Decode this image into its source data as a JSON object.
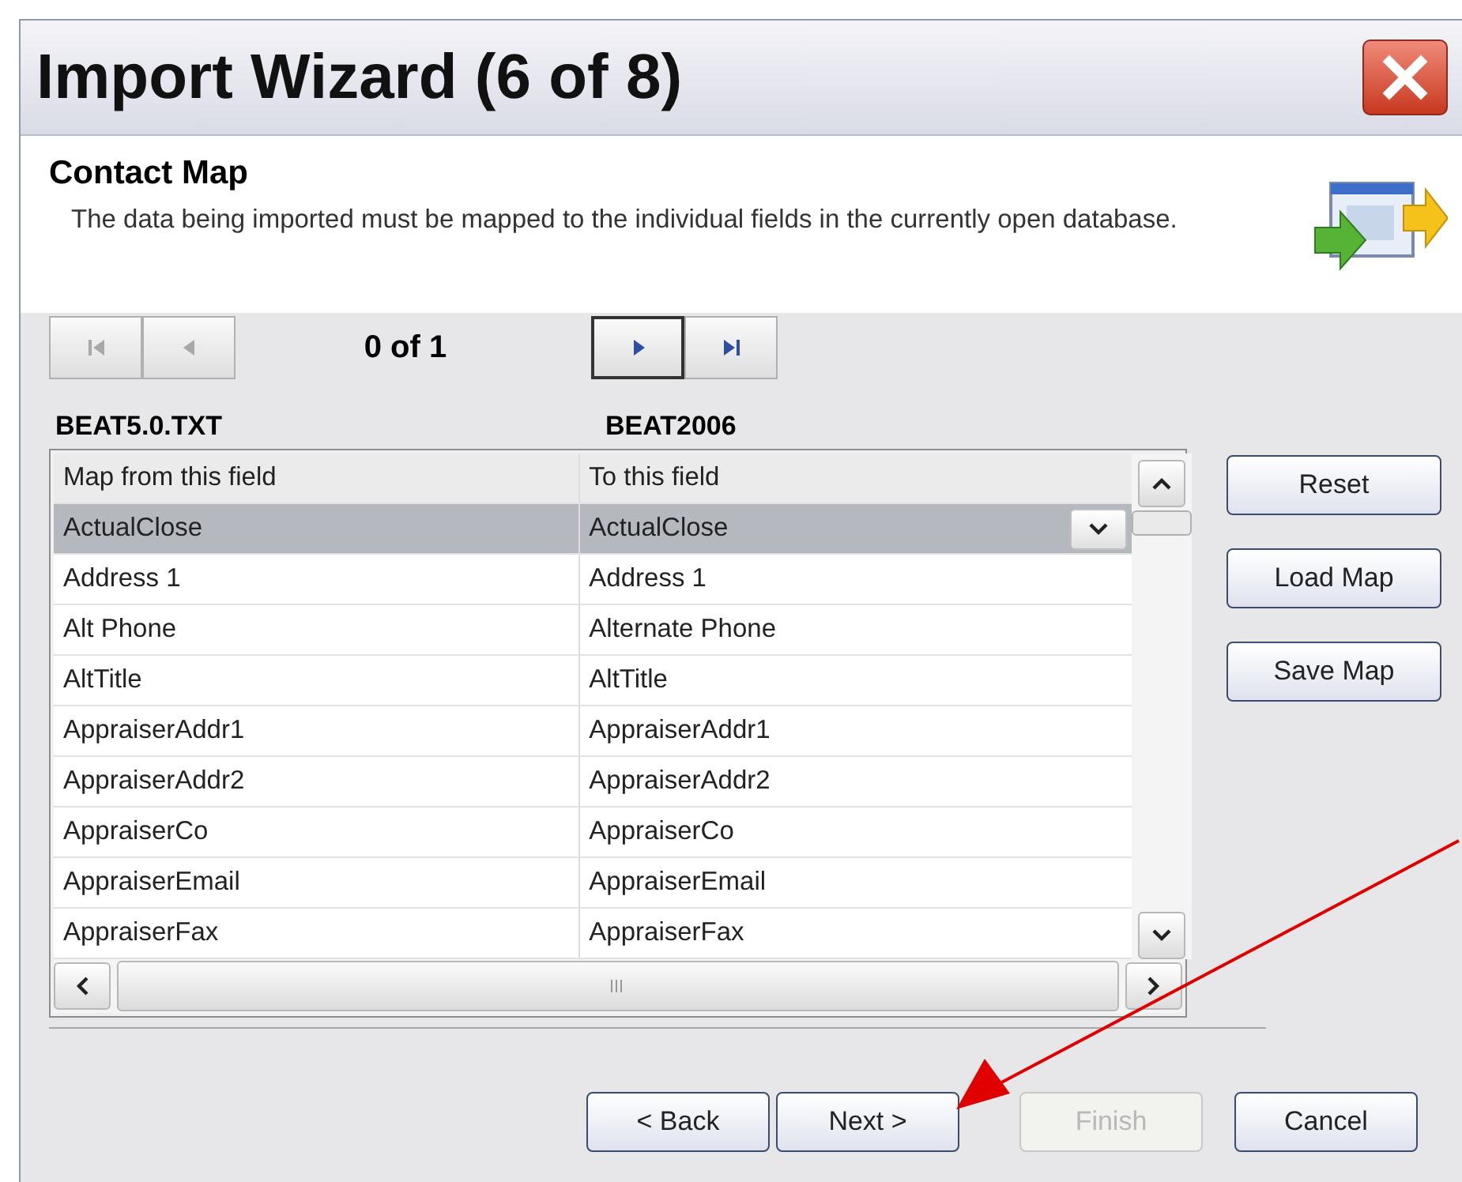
{
  "window": {
    "title": "Import Wizard (6 of 8)"
  },
  "header": {
    "title": "Contact Map",
    "description": "The data being imported must be mapped to the individual fields in the currently open database."
  },
  "navigator": {
    "position": "0 of 1",
    "buttons": [
      {
        "kind": "first",
        "disabled": true,
        "focused": false
      },
      {
        "kind": "previous",
        "disabled": true,
        "focused": false
      },
      {
        "kind": "next",
        "disabled": false,
        "focused": true
      },
      {
        "kind": "last",
        "disabled": false,
        "focused": false
      }
    ]
  },
  "source_label": "BEAT5.0.TXT",
  "target_label": "BEAT2006",
  "table": {
    "columns": [
      "Map from this field",
      "To this field"
    ],
    "rows": [
      {
        "from": "ActualClose",
        "to": "ActualClose",
        "selected": true
      },
      {
        "from": "Address 1",
        "to": "Address 1",
        "selected": false
      },
      {
        "from": "Alt Phone",
        "to": "Alternate Phone",
        "selected": false
      },
      {
        "from": "AltTitle",
        "to": "AltTitle",
        "selected": false
      },
      {
        "from": "AppraiserAddr1",
        "to": "AppraiserAddr1",
        "selected": false
      },
      {
        "from": "AppraiserAddr2",
        "to": "AppraiserAddr2",
        "selected": false
      },
      {
        "from": "AppraiserCo",
        "to": "AppraiserCo",
        "selected": false
      },
      {
        "from": "AppraiserEmail",
        "to": "AppraiserEmail",
        "selected": false
      },
      {
        "from": "AppraiserFax",
        "to": "AppraiserFax",
        "selected": false
      }
    ]
  },
  "side_buttons": [
    {
      "label": "Reset"
    },
    {
      "label": "Load Map"
    },
    {
      "label": "Save Map"
    }
  ],
  "footer_buttons": [
    {
      "label": "< Back",
      "disabled": false
    },
    {
      "label": "Next >",
      "disabled": false
    },
    {
      "label": "Finish",
      "disabled": true
    },
    {
      "label": "Cancel",
      "disabled": false
    }
  ]
}
